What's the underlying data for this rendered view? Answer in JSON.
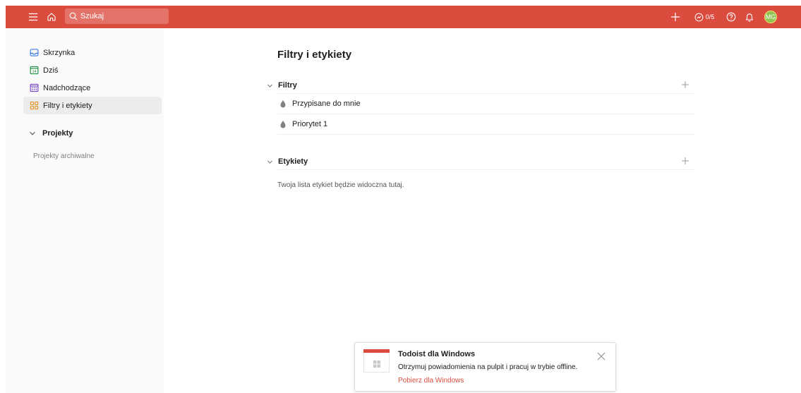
{
  "topbar": {
    "search_placeholder": "Szukaj",
    "karma": "0/5",
    "avatar_initials": "MG",
    "icons": [
      "menu-icon",
      "home-icon",
      "search-icon",
      "plus-icon",
      "productivity-icon",
      "help-icon",
      "bell-icon"
    ],
    "color": "#db4c3f"
  },
  "sidebar": {
    "items": [
      {
        "label": "Skrzynka",
        "icon": "inbox-icon",
        "color": "#246fe0"
      },
      {
        "label": "Dziś",
        "icon": "calendar-today-icon",
        "color": "#058527"
      },
      {
        "label": "Nadchodzące",
        "icon": "calendar-upcoming-icon",
        "color": "#692fc2"
      },
      {
        "label": "Filtry i etykiety",
        "icon": "filters-labels-icon",
        "color": "#eb8909",
        "active": true
      }
    ],
    "projects_label": "Projekty",
    "archived_label": "Projekty archiwalne"
  },
  "main": {
    "title": "Filtry i etykiety",
    "filters": {
      "label": "Filtry",
      "items": [
        "Przypisane do mnie",
        "Priorytet 1"
      ]
    },
    "labels": {
      "label": "Etykiety",
      "empty_text": "Twoja lista etykiet będzie widoczna tutaj."
    }
  },
  "toast": {
    "title": "Todoist dla Windows",
    "body": "Otrzymuj powiadomienia na pulpit i pracuj w trybie offline.",
    "link": "Pobierz dla Windows",
    "accent": "#db4c3f"
  }
}
